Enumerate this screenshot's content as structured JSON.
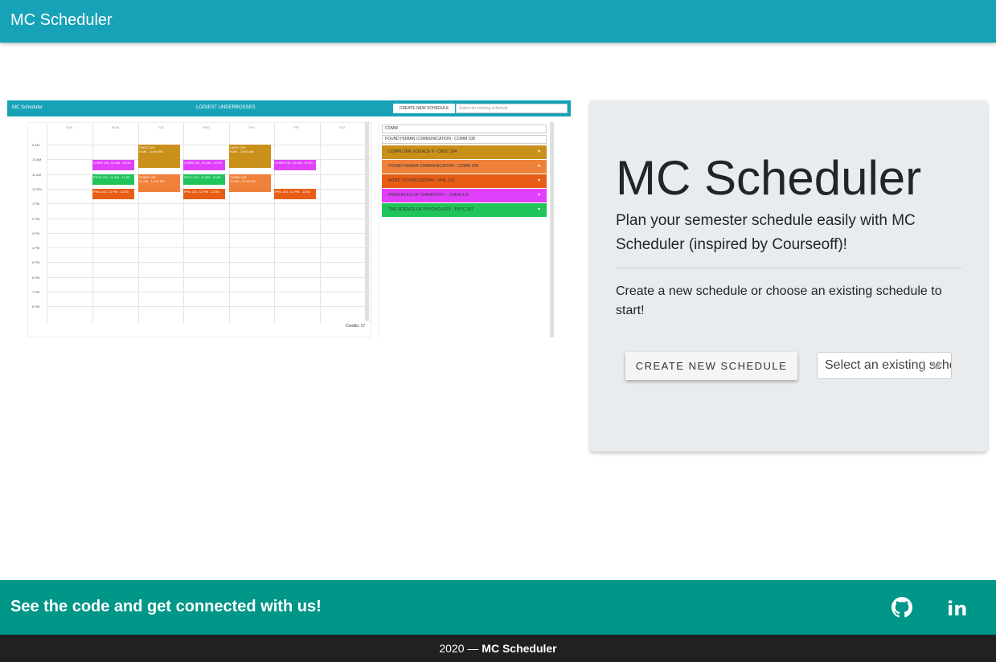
{
  "navbar": {
    "brand": "MC Scheduler"
  },
  "preview": {
    "bar_title": "MC Scheduler",
    "bar_center": "LOGIEST UNDERBOSSES",
    "create_label": "CREATE NEW SCHEDULE",
    "select_placeholder": "Select an existing schedule",
    "days": [
      "SUN",
      "MON",
      "TUE",
      "WED",
      "THU",
      "FRI",
      "SAT"
    ],
    "hours": [
      "9 AM",
      "10 AM",
      "11 AM",
      "12 PM",
      "1 PM",
      "2 PM",
      "3 PM",
      "4 PM",
      "5 PM",
      "6 PM",
      "7 PM",
      "8 PM"
    ],
    "events": [
      {
        "label": "CMSC 204",
        "time": "9 AM - 10:40 AM",
        "color": "#c9901a"
      },
      {
        "label": "CMSC 204",
        "time": "9 AM - 10:40 AM",
        "color": "#c9901a"
      },
      {
        "label": "CHEM 131, 10 AM - 10:50",
        "color": "#e040fb"
      },
      {
        "label": "CHEM 131, 10 AM - 10:50",
        "color": "#e040fb"
      },
      {
        "label": "CHEM 131, 10 AM - 10:50",
        "color": "#e040fb"
      },
      {
        "label": "PSYC 207, 11 AM - 11:50",
        "color": "#1fc45a"
      },
      {
        "label": "PSYC 207, 11 AM - 11:50",
        "color": "#1fc45a"
      },
      {
        "label": "COMM 108",
        "time": "11 AM - 12:15 PM",
        "color": "#f0813a"
      },
      {
        "label": "COMM 108",
        "time": "11 AM - 12:15 PM",
        "color": "#f0813a"
      },
      {
        "label": "PHIL 101, 12 PM - 12:50",
        "color": "#e85d15"
      },
      {
        "label": "PHIL 101, 12 PM - 12:50",
        "color": "#e85d15"
      },
      {
        "label": "PHIL 101, 12 PM - 12:50",
        "color": "#e85d15"
      }
    ],
    "credits": "Credits: 17",
    "search_value": "COMM",
    "selected_course": "FOUND HUMAN COMMUNICATION - COMM 108",
    "courses": [
      {
        "label": "COMPUTER SCIENCE II - CMSC 204",
        "color": "#c9901a"
      },
      {
        "label": "FOUND HUMAN COMMUNICATION - COMM 108",
        "color": "#f0813a"
      },
      {
        "label": "INTRO TO PHILOSOPHY - PHIL 101",
        "color": "#e85d15"
      },
      {
        "label": "PRINCIPLES OF CHEMISTRY I - CHEM 131",
        "color": "#e040fb"
      },
      {
        "label": "THE SCIENCE OF PSYCHOLOGY - PSYC 207",
        "color": "#1fc45a"
      }
    ]
  },
  "hero": {
    "title": "MC Scheduler",
    "lead": "Plan your semester schedule easily with MC Scheduler (inspired by Courseoff)!",
    "description": "Create a new schedule or choose an existing schedule to start!",
    "create_button": "CREATE NEW SCHEDULE",
    "select_value": "Select an existing schedule"
  },
  "footer": {
    "message": "See the code and get connected with us!",
    "linkedin_text": "in",
    "copyright_prefix": "2020 — ",
    "copyright_brand": "MC Scheduler"
  },
  "colors": {
    "navbar": "#17a2b8",
    "footer": "#009688",
    "bottom_bar": "#212121",
    "card": "#e9ecef"
  },
  "icons": {
    "github": "github-icon",
    "linkedin": "linkedin-icon",
    "chevron": "chevron-down-icon"
  }
}
